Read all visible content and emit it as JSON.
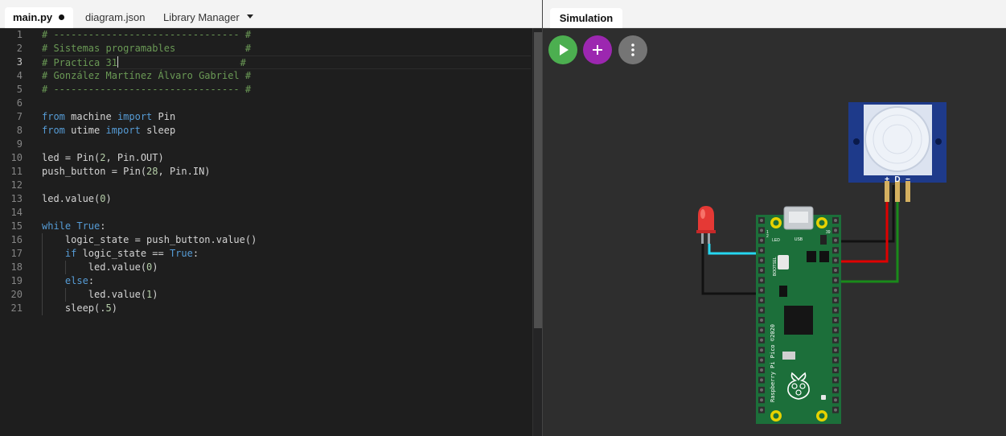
{
  "editor": {
    "tabs": [
      {
        "label": "main.py",
        "modified": true
      },
      {
        "label": "diagram.json"
      },
      {
        "label": "Library Manager"
      }
    ],
    "current_line": 3,
    "lines": [
      [
        {
          "t": "cmt",
          "v": "# -------------------------------- #"
        }
      ],
      [
        {
          "t": "cmt",
          "v": "# Sistemas programables            #"
        }
      ],
      [
        {
          "t": "cmt",
          "v": "# Practica 31"
        },
        {
          "t": "caret"
        },
        {
          "t": "cmt",
          "v": "                     #"
        }
      ],
      [
        {
          "t": "cmt",
          "v": "# González Martínez Álvaro Gabriel #"
        }
      ],
      [
        {
          "t": "cmt",
          "v": "# -------------------------------- #"
        }
      ],
      [],
      [
        {
          "t": "kw",
          "v": "from"
        },
        {
          "t": "p",
          "v": " machine "
        },
        {
          "t": "kw",
          "v": "import"
        },
        {
          "t": "p",
          "v": " Pin"
        }
      ],
      [
        {
          "t": "kw",
          "v": "from"
        },
        {
          "t": "p",
          "v": " utime "
        },
        {
          "t": "kw",
          "v": "import"
        },
        {
          "t": "p",
          "v": " sleep"
        }
      ],
      [],
      [
        {
          "t": "p",
          "v": "led = Pin("
        },
        {
          "t": "num",
          "v": "2"
        },
        {
          "t": "p",
          "v": ", Pin.OUT)"
        }
      ],
      [
        {
          "t": "p",
          "v": "push_button = Pin("
        },
        {
          "t": "num",
          "v": "28"
        },
        {
          "t": "p",
          "v": ", Pin.IN)"
        }
      ],
      [],
      [
        {
          "t": "p",
          "v": "led.value("
        },
        {
          "t": "num",
          "v": "0"
        },
        {
          "t": "p",
          "v": ")"
        }
      ],
      [],
      [
        {
          "t": "kw",
          "v": "while"
        },
        {
          "t": "p",
          "v": " "
        },
        {
          "t": "kw",
          "v": "True"
        },
        {
          "t": "p",
          "v": ":"
        }
      ],
      [
        {
          "t": "p",
          "v": "    logic_state = push_button.value()"
        }
      ],
      [
        {
          "t": "p",
          "v": "    "
        },
        {
          "t": "kw",
          "v": "if"
        },
        {
          "t": "p",
          "v": " logic_state == "
        },
        {
          "t": "kw",
          "v": "True"
        },
        {
          "t": "p",
          "v": ":"
        }
      ],
      [
        {
          "t": "p",
          "v": "        led.value("
        },
        {
          "t": "num",
          "v": "0"
        },
        {
          "t": "p",
          "v": ")"
        }
      ],
      [
        {
          "t": "p",
          "v": "    "
        },
        {
          "t": "kw",
          "v": "else"
        },
        {
          "t": "p",
          "v": ":"
        }
      ],
      [
        {
          "t": "p",
          "v": "        led.value("
        },
        {
          "t": "num",
          "v": "1"
        },
        {
          "t": "p",
          "v": ")"
        }
      ],
      [
        {
          "t": "p",
          "v": "    sleep(."
        },
        {
          "t": "num",
          "v": "5"
        },
        {
          "t": "p",
          "v": ")"
        }
      ]
    ],
    "indent_levels": [
      0,
      0,
      0,
      0,
      0,
      0,
      0,
      0,
      0,
      0,
      0,
      0,
      0,
      0,
      0,
      1,
      1,
      2,
      1,
      2,
      1
    ]
  },
  "simulation": {
    "tab_label": "Simulation",
    "buttons": {
      "play": "play-icon",
      "add": "plus-icon",
      "more": "more-vertical-icon"
    },
    "pir_labels": {
      "plus": "+",
      "d": "D",
      "minus": "−"
    },
    "pico": {
      "led_label": "LED",
      "usb_label": "USB",
      "bootsel_label": "BOOTSEL",
      "pin_top_left": "1",
      "pin_top_left_2": "2",
      "pin_top_right": "39",
      "board_text": "Raspberry Pi Pico ©2020"
    },
    "colors": {
      "board": "#1c6f3a",
      "led": "#e53935",
      "wire_cyan": "#25d7f0",
      "wire_red": "#e00000",
      "wire_green": "#1a8a1a",
      "wire_black": "#111111",
      "pir_frame": "#1e3a8a"
    }
  }
}
